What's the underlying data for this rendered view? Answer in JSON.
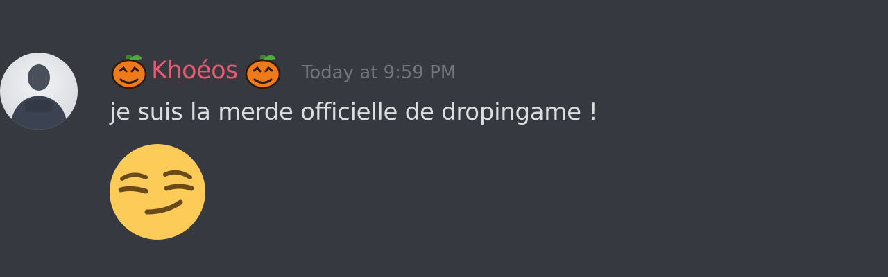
{
  "colors": {
    "background": "#36393f",
    "username": "#e85a72",
    "timestamp": "#72767d",
    "message_text": "#dcddde"
  },
  "message": {
    "prefix_icon": "pumpkin-icon",
    "username": "Khoéos",
    "suffix_icon": "pumpkin-icon",
    "timestamp": "Today at 9:59 PM",
    "text": "je suis la merde officielle de dropingame !",
    "emoji": "smirking-face-emoji"
  }
}
